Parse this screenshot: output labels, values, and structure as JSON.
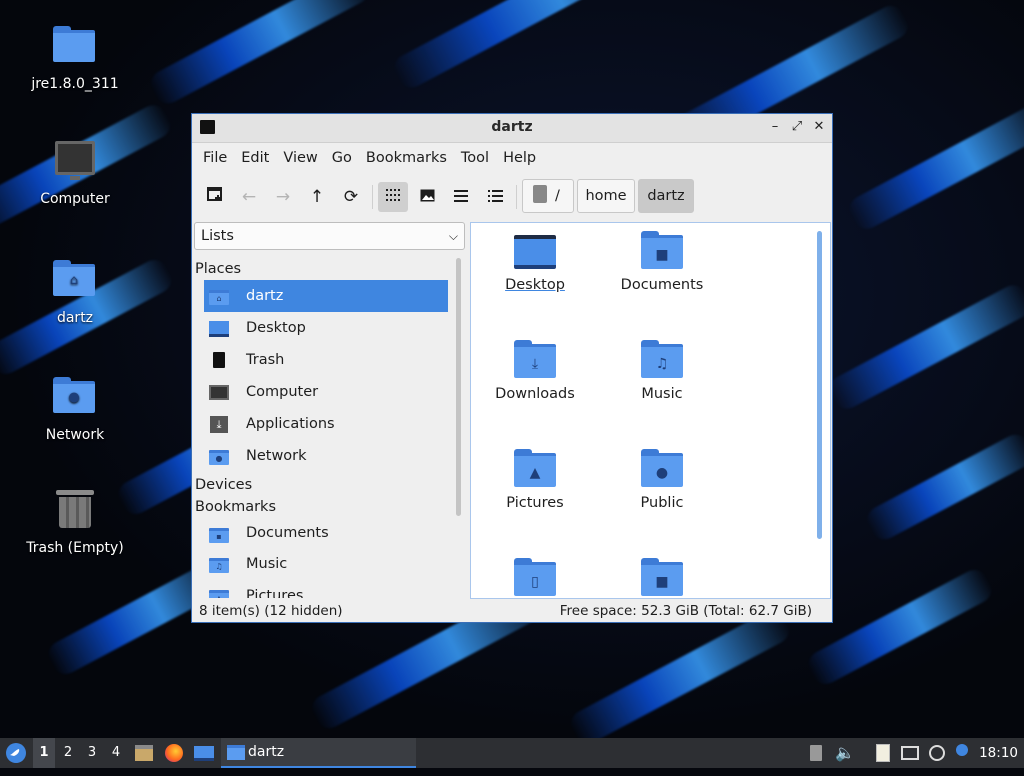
{
  "desktop": {
    "icons": [
      {
        "label": "jre1.8.0_311",
        "icon": "folder-icon"
      },
      {
        "label": "Computer",
        "icon": "computer-icon"
      },
      {
        "label": "dartz",
        "icon": "home-folder-icon"
      },
      {
        "label": "Network",
        "icon": "network-folder-icon"
      },
      {
        "label": "Trash (Empty)",
        "icon": "trash-icon"
      }
    ]
  },
  "window": {
    "title": "dartz",
    "controls": {
      "minimize": "–",
      "maximize": "⤢",
      "close": "✕"
    },
    "menu": [
      "File",
      "Edit",
      "View",
      "Go",
      "Bookmarks",
      "Tool",
      "Help"
    ],
    "toolbar": {
      "new_tab": "new-tab-icon",
      "back": "←",
      "forward": "→",
      "up": "↑",
      "reload": "⟳",
      "view_icons": "icon-view-icon",
      "view_thumbnails": "thumbnail-view-icon",
      "view_compact": "compact-view-icon",
      "view_list": "list-view-icon"
    },
    "path": {
      "root": "/",
      "segments": [
        "home",
        "dartz"
      ],
      "active": "dartz"
    },
    "side_pane": {
      "mode": "Lists",
      "sections": {
        "places": "Places",
        "devices": "Devices",
        "bookmarks": "Bookmarks"
      },
      "places": [
        "dartz",
        "Desktop",
        "Trash",
        "Computer",
        "Applications",
        "Network"
      ],
      "selected": "dartz",
      "bookmarks": [
        "Documents",
        "Music",
        "Pictures"
      ]
    },
    "files": [
      {
        "name": "Desktop"
      },
      {
        "name": "Documents"
      },
      {
        "name": "Downloads"
      },
      {
        "name": "Music"
      },
      {
        "name": "Pictures"
      },
      {
        "name": "Public"
      },
      {
        "name": ""
      },
      {
        "name": ""
      }
    ],
    "status": {
      "items": "8 item(s) (12 hidden)",
      "free_space": "Free space: 52.3 GiB (Total: 62.7 GiB)"
    }
  },
  "taskbar": {
    "workspaces": [
      "1",
      "2",
      "3",
      "4"
    ],
    "active_workspace": "1",
    "task": "dartz",
    "clock": "18:10"
  },
  "colors": {
    "accent": "#3f86e0",
    "folder": "#5b9cf0",
    "taskbar": "#2d2f33"
  }
}
